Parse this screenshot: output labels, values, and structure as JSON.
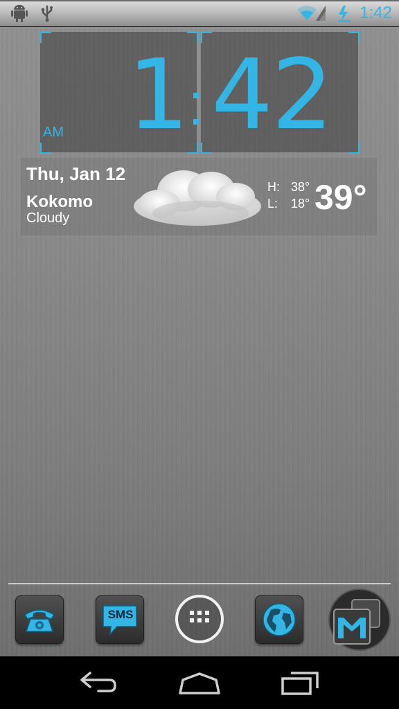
{
  "status_bar": {
    "time": "1:42",
    "left_icons": [
      "android-debug-icon",
      "usb-icon"
    ],
    "right_icons": [
      "wifi-icon",
      "signal-icon",
      "battery-charging-icon"
    ]
  },
  "clock": {
    "hour": "1",
    "minutes": "42",
    "ampm": "AM",
    "accent": "#33b5e5"
  },
  "weather": {
    "date": "Thu, Jan 12",
    "city": "Kokomo",
    "condition": "Cloudy",
    "high_label": "H:",
    "high": "38°",
    "low_label": "L:",
    "low": "18°",
    "current_temp": "39°",
    "icon": "cloud-icon"
  },
  "dock": {
    "items": [
      {
        "name": "phone",
        "icon": "phone-icon"
      },
      {
        "name": "messaging",
        "icon": "sms-icon",
        "label": "SMS"
      },
      {
        "name": "app-drawer",
        "icon": "app-drawer-icon"
      },
      {
        "name": "browser",
        "icon": "globe-icon"
      },
      {
        "name": "gmail",
        "icon": "gmail-icon"
      }
    ]
  },
  "nav_bar": {
    "buttons": [
      "back",
      "home",
      "recent-apps"
    ]
  }
}
